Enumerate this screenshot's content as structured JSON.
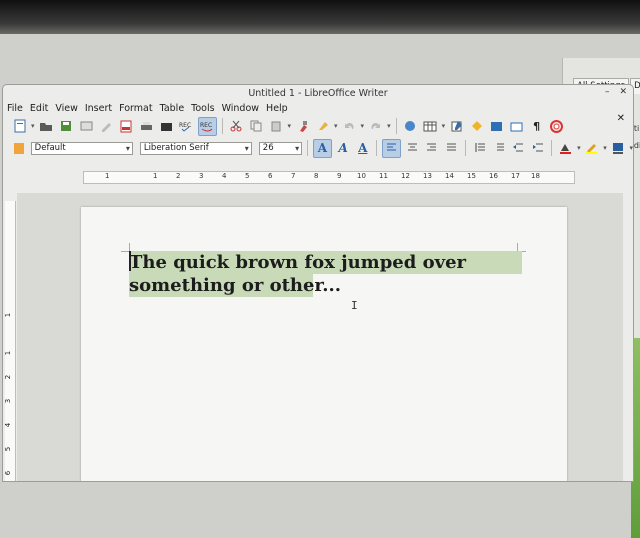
{
  "background": {
    "tabs": [
      "All Settings",
      "Deta"
    ],
    "side_text": [
      "ati",
      "edi"
    ]
  },
  "window": {
    "title": "Untitled 1 - LibreOffice Writer",
    "controls": [
      "–",
      "✕"
    ],
    "doc_close": "✕"
  },
  "menu": [
    "File",
    "Edit",
    "View",
    "Insert",
    "Format",
    "Table",
    "Tools",
    "Window",
    "Help"
  ],
  "formatting": {
    "style": "Default",
    "font": "Liberation Serif",
    "size": "26"
  },
  "ruler": {
    "numbers": [
      "1",
      "1",
      "2",
      "3",
      "4",
      "5",
      "6",
      "7",
      "8",
      "9",
      "10",
      "11",
      "12",
      "13",
      "14",
      "15",
      "16",
      "17",
      "18"
    ],
    "vertical_numbers": [
      "1",
      "1",
      "2",
      "3",
      "4",
      "5",
      "6",
      "7",
      "8",
      "9"
    ]
  },
  "document": {
    "line1": "The quick brown fox jumped over",
    "line2": "something or other..."
  },
  "colors": {
    "selection": "#c8dab8",
    "active_button": "#b8cde6"
  }
}
